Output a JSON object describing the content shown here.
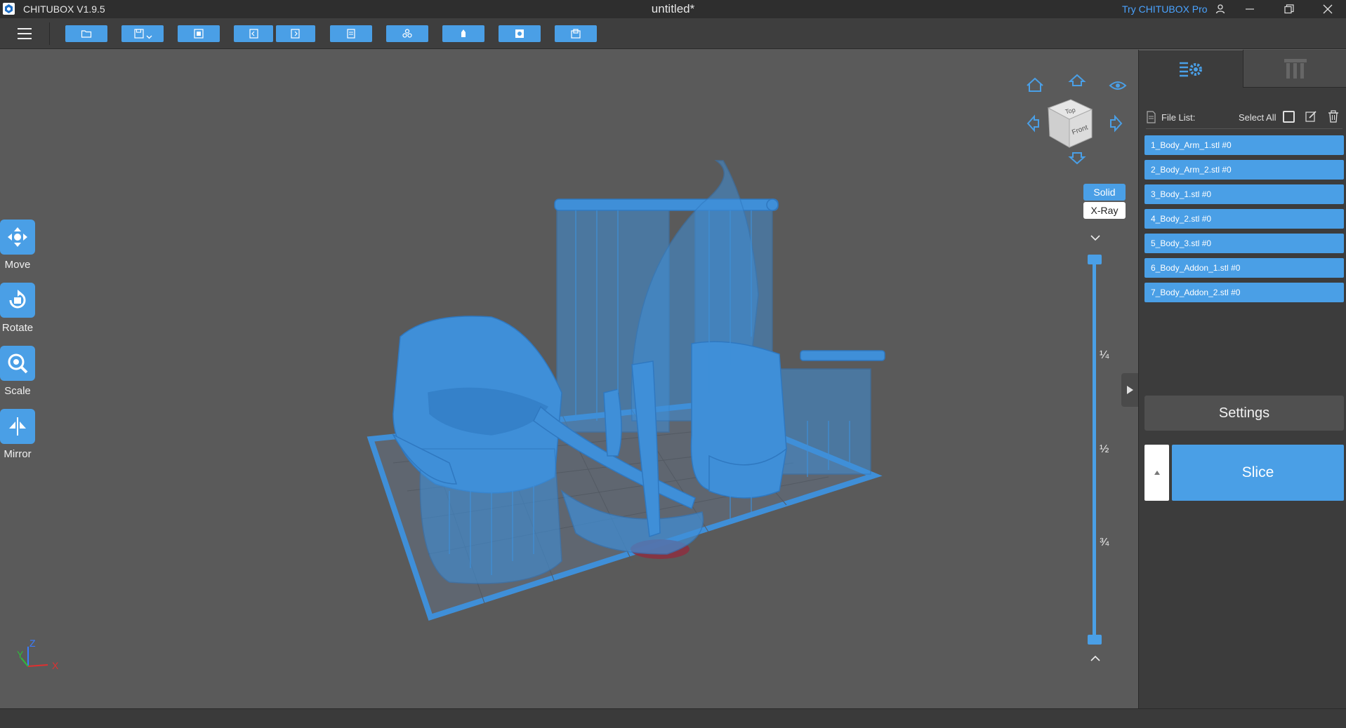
{
  "titlebar": {
    "app_name": "CHITUBOX V1.9.5",
    "doc_title": "untitled*",
    "try_pro": "Try CHITUBOX Pro"
  },
  "toolbar": {
    "buttons": [
      "open-file",
      "save",
      "auto-layout",
      "undo",
      "redo",
      "slice-settings",
      "machine",
      "support",
      "hollow",
      "drill"
    ]
  },
  "left_tools": [
    {
      "label": "Move",
      "icon": "move-icon"
    },
    {
      "label": "Rotate",
      "icon": "rotate-icon"
    },
    {
      "label": "Scale",
      "icon": "scale-icon"
    },
    {
      "label": "Mirror",
      "icon": "mirror-icon"
    }
  ],
  "viewcube": {
    "top_label": "Top",
    "front_label": "Front"
  },
  "view_modes": {
    "solid": "Solid",
    "xray": "X-Ray"
  },
  "layer_slider": {
    "fractions": [
      "¼",
      "½",
      "¾"
    ]
  },
  "axis": {
    "x": "X",
    "y": "Y",
    "z": "Z"
  },
  "panel": {
    "file_list_label": "File List:",
    "select_all_label": "Select All",
    "files": [
      "1_Body_Arm_1.stl #0",
      "2_Body_Arm_2.stl #0",
      "3_Body_1.stl #0",
      "4_Body_2.stl #0",
      "5_Body_3.stl #0",
      "6_Body_Addon_1.stl #0",
      "7_Body_Addon_2.stl #0"
    ],
    "settings_label": "Settings",
    "slice_label": "Slice"
  },
  "colors": {
    "accent": "#4a9fe6",
    "model": "#3f8fd8",
    "background": "#5a5a5a",
    "panel": "#3c3c3c"
  }
}
